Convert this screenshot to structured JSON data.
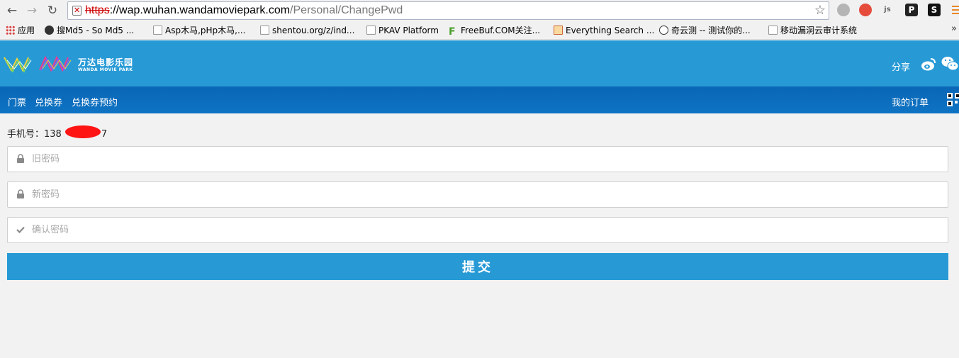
{
  "browser": {
    "url_scheme": "https",
    "url_sep": "://",
    "url_host": "wap.wuhan.wandamoviepark.com",
    "url_path": "/Personal/ChangePwd",
    "bookmarks": [
      {
        "label": "应用",
        "icon": "apps-icon"
      },
      {
        "label": "搜Md5 - So Md5 ...",
        "icon": "md5-icon"
      },
      {
        "label": "Asp木马,pHp木马,...",
        "icon": "page-icon"
      },
      {
        "label": "shentou.org/z/ind...",
        "icon": "page-icon"
      },
      {
        "label": "PKAV Platform",
        "icon": "page-icon"
      },
      {
        "label": "FreeBuf.COM关注...",
        "icon": "freebuf-icon"
      },
      {
        "label": "Everything Search ...",
        "icon": "search-icon"
      },
      {
        "label": "奇云测 -- 测试你的...",
        "icon": "clock-icon"
      },
      {
        "label": "移动漏洞云审计系统",
        "icon": "page-icon"
      }
    ],
    "ext_p": "P",
    "ext_s": "S",
    "ext_js": "js"
  },
  "header": {
    "logo_cn": "万达电影乐园",
    "logo_en": "WANDA MOVIE PARK",
    "share_label": "分享",
    "brand_color": "#279ad6",
    "nav_color": "#0a66b6"
  },
  "nav": {
    "items": [
      "门票",
      "兑换券",
      "兑换券预约"
    ],
    "my_orders": "我的订单"
  },
  "form": {
    "phone_label": "手机号：",
    "phone_prefix": "138",
    "phone_suffix": "7",
    "old_password_placeholder": "旧密码",
    "new_password_placeholder": "新密码",
    "confirm_password_placeholder": "确认密码",
    "submit_label": "提交"
  }
}
